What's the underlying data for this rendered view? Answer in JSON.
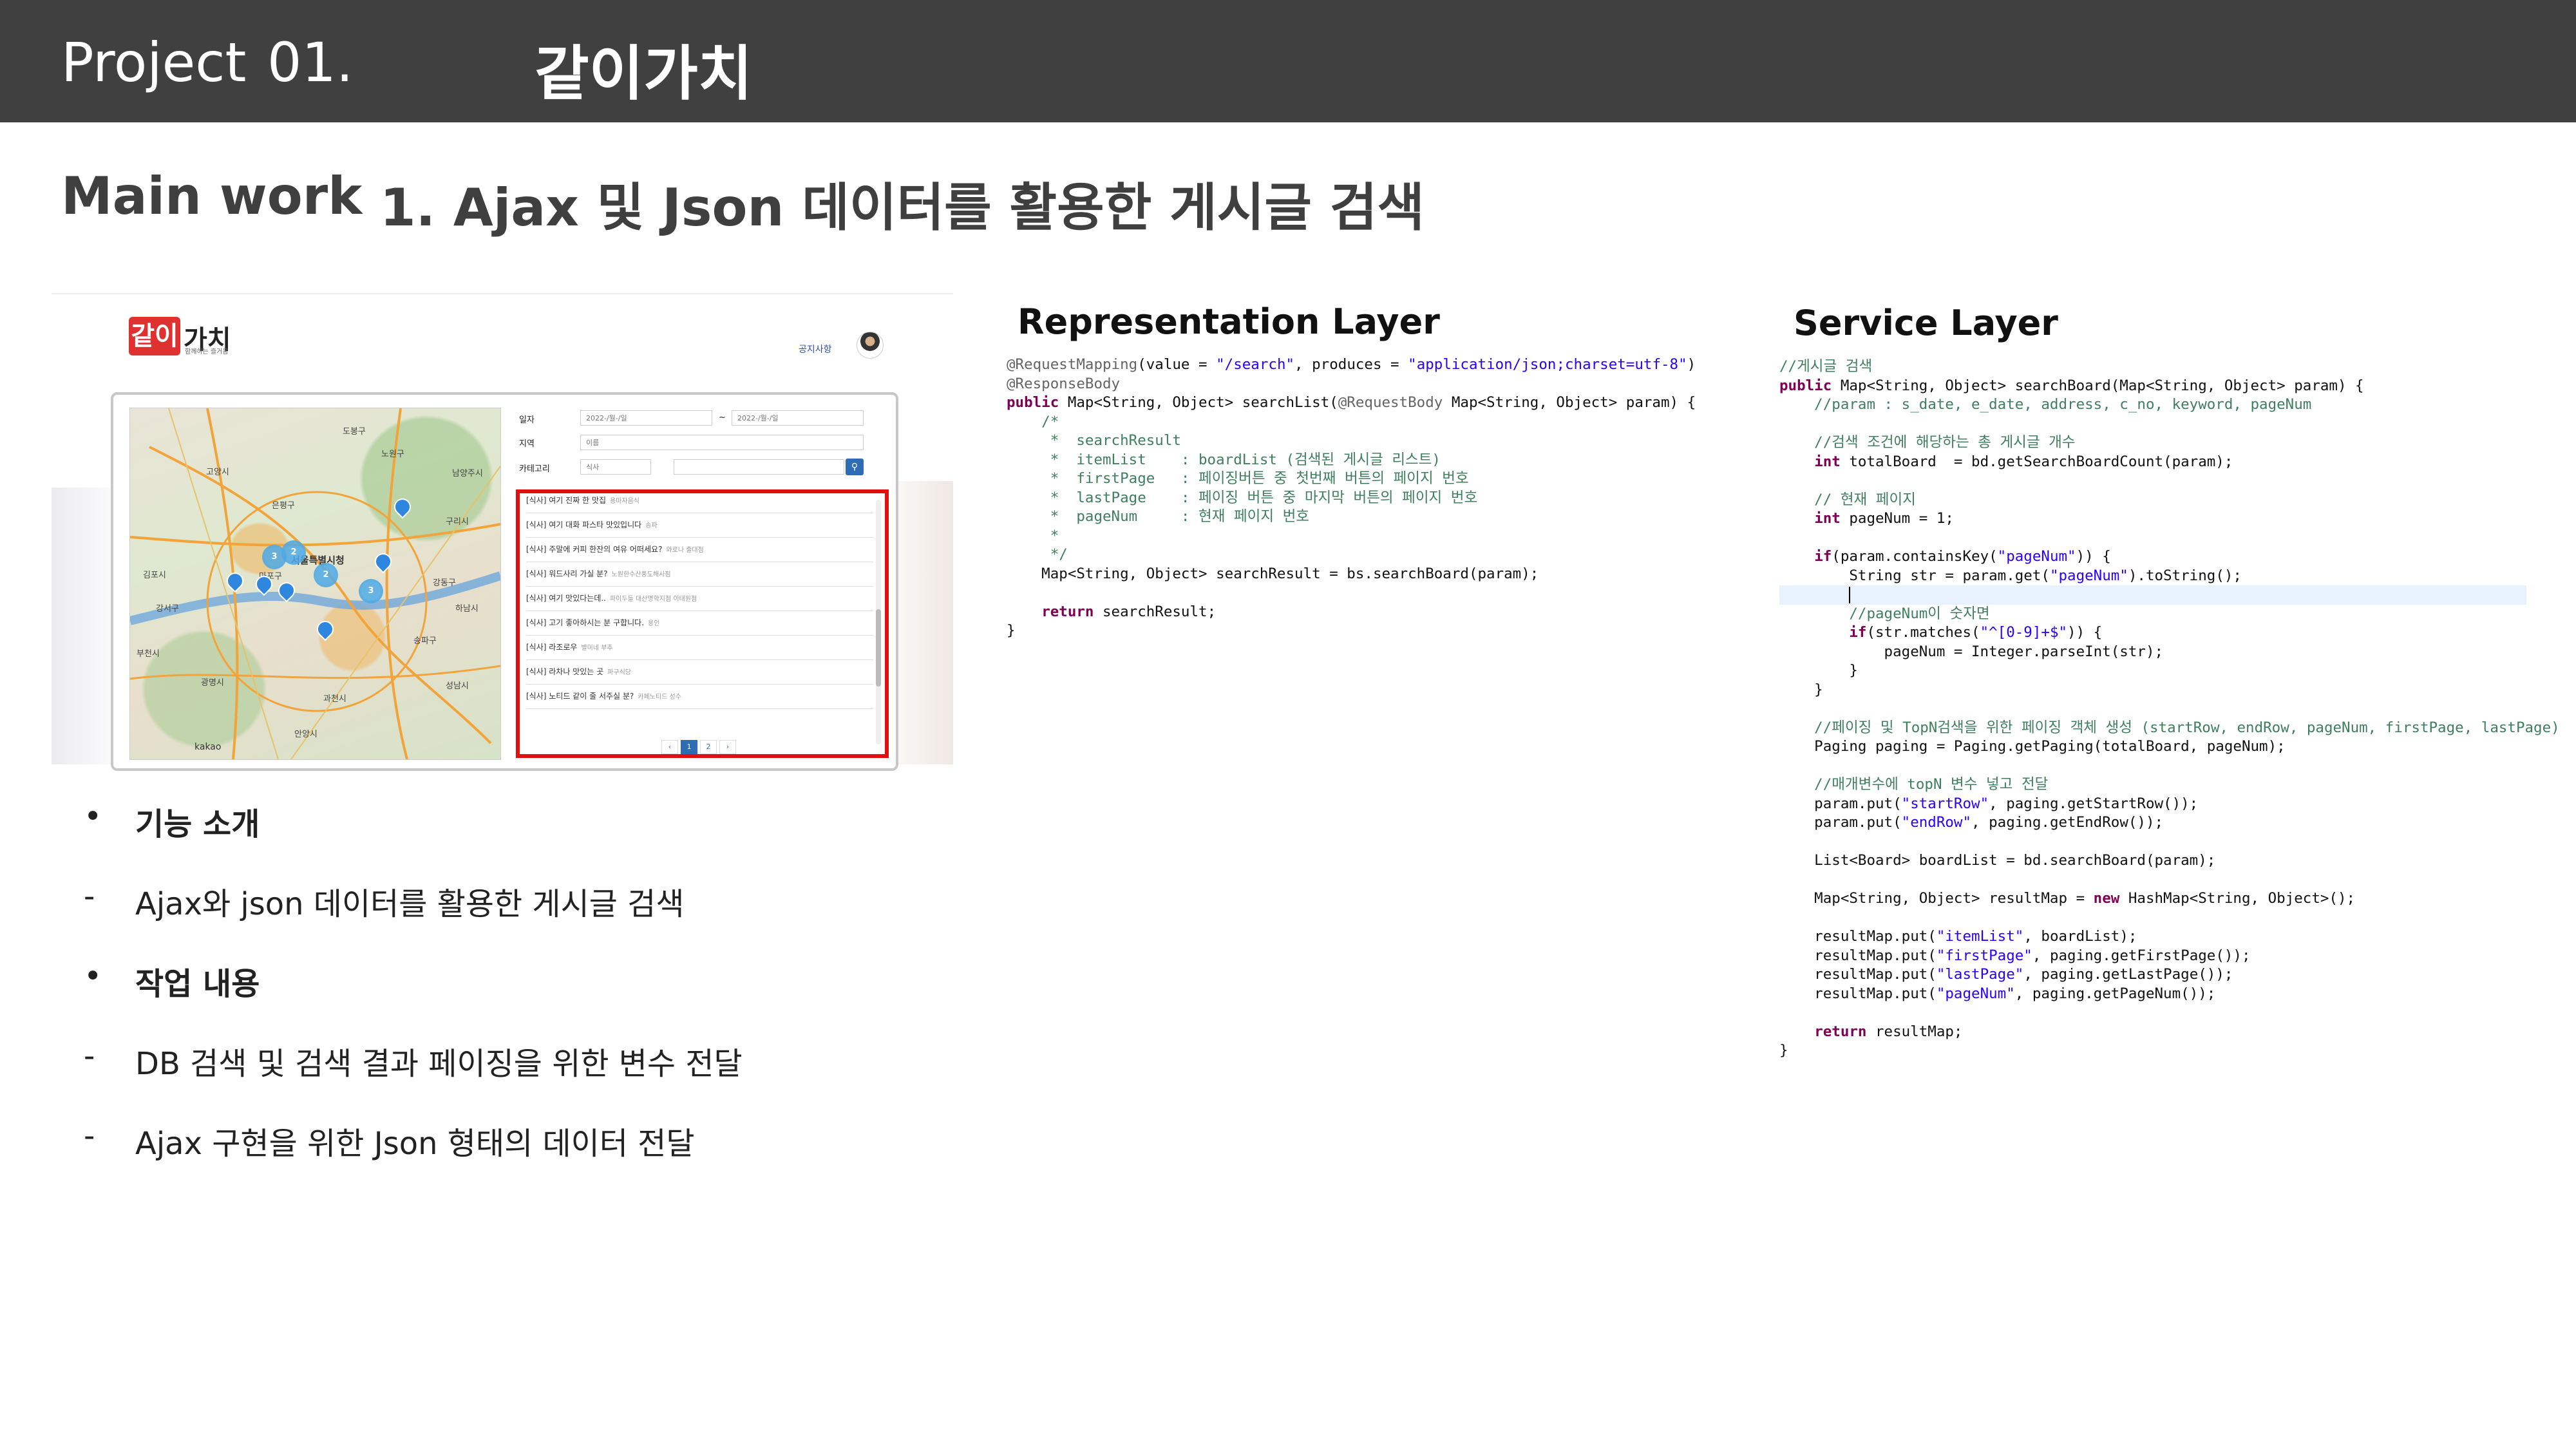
{
  "header": {
    "project_label": "Project",
    "project_number": "01.",
    "project_name": "같이가치"
  },
  "main_work": {
    "label": "Main work",
    "title": "1. Ajax 및 Json 데이터를 활용한 게시글 검색"
  },
  "app_screenshot": {
    "logo_mark": "같이",
    "logo_text": "가치",
    "logo_subtitle": "함께하는 즐거움",
    "notice_link": "공지사항",
    "form": {
      "date_label": "일자",
      "date_start": "2022-/월-/일",
      "date_tilde": "~",
      "date_end": "2022-/월-/일",
      "region_label": "지역",
      "region_value": "이름",
      "category_label": "카테고리",
      "category_value": "식사"
    },
    "results": [
      {
        "title": "[식사] 여기 진짜 한 맛집",
        "meta": "용마자음식"
      },
      {
        "title": "[식사] 여기 대화 파스타 맛있입니다",
        "meta": "송파"
      },
      {
        "title": "[식사] 주말에 커피 한잔의 여유 어떠세요?",
        "meta": "와로나 출대점"
      },
      {
        "title": "[식사] 워드사리 가실 분?",
        "meta": "노원한수산풍도해사점"
      },
      {
        "title": "[식사] 여기 맛있다는데..",
        "meta": "파이두들 대산명학지점 이태원점"
      },
      {
        "title": "[식사] 고기 좋아하시는 분 구합니다.",
        "meta": "용인"
      },
      {
        "title": "[식사] 라조로우",
        "meta": "별미네 부추"
      },
      {
        "title": "[식사] 라차나 맛있는 곳",
        "meta": "파구식당"
      },
      {
        "title": "[식사] 노티드 같이 줄 서주실 분?",
        "meta": "카페노티드 성수"
      }
    ],
    "pager": [
      "‹",
      "1",
      "2",
      "›"
    ],
    "map": {
      "city_label": "서울특별시청",
      "attribution": "kakao",
      "clusters": [
        "3",
        "2",
        "2",
        "3"
      ],
      "place_labels": [
        "고양시",
        "김포시",
        "부천시",
        "광명시",
        "과천시",
        "안양시",
        "구리시",
        "남양주시",
        "하남시",
        "성남시",
        "강동구",
        "송파구",
        "강서구",
        "마포구",
        "노원구",
        "도봉구",
        "은평구"
      ]
    }
  },
  "bullets": [
    {
      "marker": "•",
      "text": "기능 소개",
      "bold": true
    },
    {
      "marker": "-",
      "text": "Ajax와 json 데이터를 활용한 게시글 검색",
      "bold": false
    },
    {
      "marker": "•",
      "text": "작업 내용",
      "bold": true
    },
    {
      "marker": "-",
      "text": "DB 검색 및 검색 결과 페이징을 위한 변수 전달",
      "bold": false
    },
    {
      "marker": "-",
      "text": "Ajax 구현을 위한 Json 형태의 데이터 전달",
      "bold": false
    }
  ],
  "representation_layer": {
    "title": "Representation Layer",
    "code": [
      "@RequestMapping(value = \"/search\", produces = \"application/json;charset=utf-8\")",
      "@ResponseBody",
      "public Map<String, Object> searchList(@RequestBody Map<String, Object> param) {",
      "    /*",
      "     *  searchResult",
      "     *  itemList    : boardList (검색된 게시글 리스트)",
      "     *  firstPage   : 페이징버튼 중 첫번째 버튼의 페이지 번호",
      "     *  lastPage    : 페이징 버튼 중 마지막 버튼의 페이지 번호",
      "     *  pageNum     : 현재 페이지 번호",
      "     *",
      "     */",
      "    Map<String, Object> searchResult = bs.searchBoard(param);",
      "",
      "    return searchResult;",
      "}"
    ]
  },
  "service_layer": {
    "title": "Service Layer",
    "code": [
      "//게시글 검색",
      "public Map<String, Object> searchBoard(Map<String, Object> param) {",
      "    //param : s_date, e_date, address, c_no, keyword, pageNum",
      "",
      "    //검색 조건에 해당하는 총 게시글 개수",
      "    int totalBoard  = bd.getSearchBoardCount(param);",
      "",
      "    // 현재 페이지",
      "    int pageNum = 1;",
      "",
      "    if(param.containsKey(\"pageNum\")) {",
      "        String str = param.get(\"pageNum\").toString();",
      "",
      "        //pageNum이 숫자면",
      "        if(str.matches(\"^[0-9]+$\")) {",
      "            pageNum = Integer.parseInt(str);",
      "        }",
      "    }",
      "",
      "    //페이징 및 TopN검색을 위한 페이징 객체 생성 (startRow, endRow, pageNum, firstPage, lastPage)",
      "    Paging paging = Paging.getPaging(totalBoard, pageNum);",
      "",
      "    //매개변수에 topN 변수 넣고 전달",
      "    param.put(\"startRow\", paging.getStartRow());",
      "    param.put(\"endRow\", paging.getEndRow());",
      "",
      "    List<Board> boardList = bd.searchBoard(param);",
      "",
      "    Map<String, Object> resultMap = new HashMap<String, Object>();",
      "",
      "    resultMap.put(\"itemList\", boardList);",
      "    resultMap.put(\"firstPage\", paging.getFirstPage());",
      "    resultMap.put(\"lastPage\", paging.getLastPage());",
      "    resultMap.put(\"pageNum\", paging.getPageNum());",
      "",
      "    return resultMap;",
      "}"
    ]
  }
}
